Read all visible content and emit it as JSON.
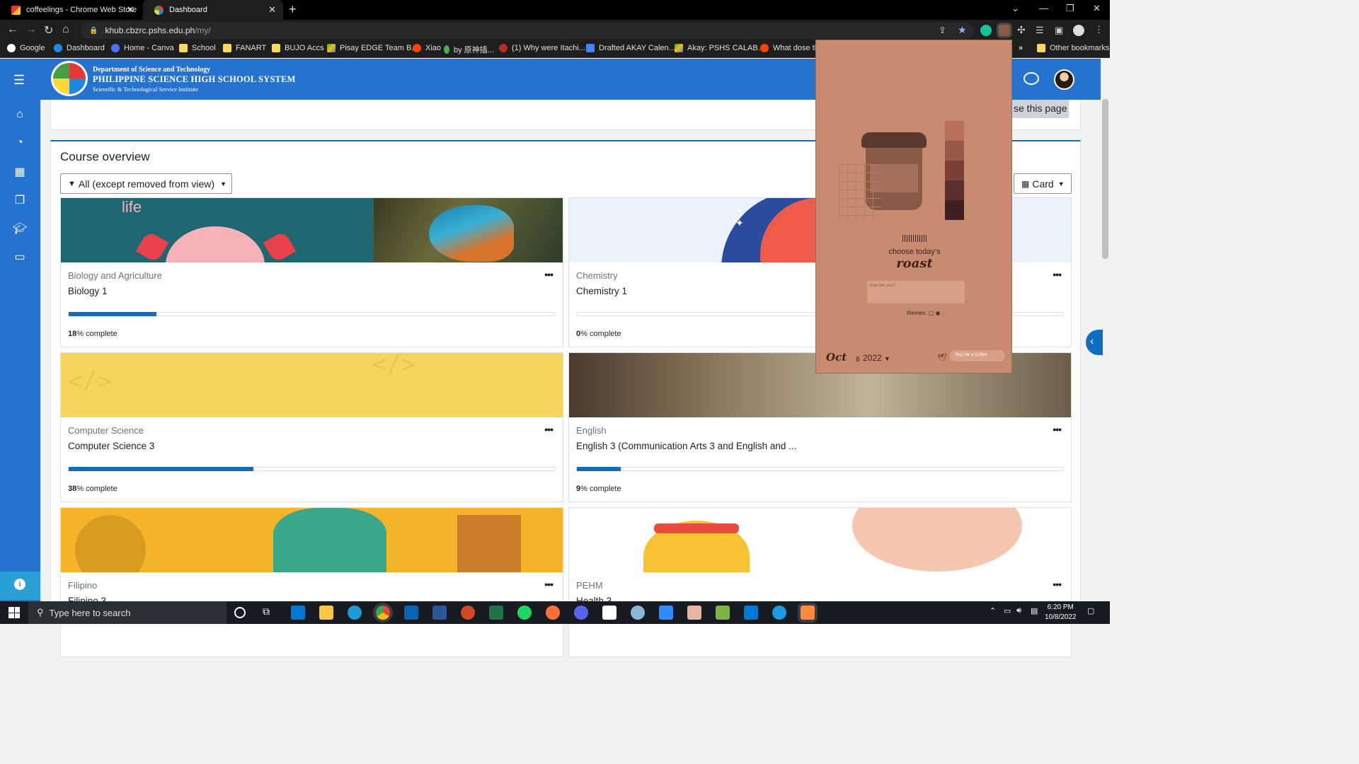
{
  "browser": {
    "tabs": [
      {
        "title": "coffeelings - Chrome Web Store"
      },
      {
        "title": "Dashboard"
      }
    ],
    "url_host": "khub.cbzrc.pshs.edu.ph",
    "url_path": "/my/",
    "bookmarks": [
      "Google",
      "Dashboard",
      "Home - Canva",
      "School",
      "FANART",
      "BUJO Accs",
      "Pisay EDGE Team B...",
      "Xiao",
      "by 原神插...",
      "(1) Why were Itachi...",
      "Drafted AKAY Calen...",
      "Akay: PSHS CALAB...",
      "What dose th"
    ],
    "bookmarks_overflow": "»",
    "other_bookmarks": "Other bookmarks"
  },
  "header": {
    "org_line1": "Department of Science and Technology",
    "org_line2": "PHILIPPINE SCIENCE HIGH SCHOOL SYSTEM",
    "org_line3": "Scientific & Technological Service Institute"
  },
  "top_card": {
    "reset_label": "se this page"
  },
  "course_overview": {
    "title": "Course overview",
    "filter_label": "All (except removed from view)",
    "view_label": "Card",
    "courses": [
      {
        "category": "Biology and Agriculture",
        "name": "Biology 1",
        "progress": 18,
        "complete_label": "% complete",
        "progress_pct": "18"
      },
      {
        "category": "Chemistry",
        "name": "Chemistry 1",
        "progress": 0,
        "complete_label": "% complete",
        "progress_pct": "0"
      },
      {
        "category": "Computer Science",
        "name": "Computer Science 3",
        "progress": 38,
        "complete_label": "% complete",
        "progress_pct": "38"
      },
      {
        "category": "English",
        "name": "English 3 (Communication Arts 3 and English and ...",
        "progress": 9,
        "complete_label": "% complete",
        "progress_pct": "9"
      },
      {
        "category": "Filipino",
        "name": "Filipino 3",
        "progress": null,
        "complete_label": "",
        "progress_pct": ""
      },
      {
        "category": "PEHM",
        "name": "Health 3",
        "progress": null,
        "complete_label": "",
        "progress_pct": ""
      }
    ],
    "banner_text": "life"
  },
  "extension_popup": {
    "line1": "choose today's",
    "line2": "roast",
    "input_placeholder": "how are you?",
    "themes_label": "themes:",
    "month": "Oct",
    "day": "8",
    "year": "2022",
    "bmc_label": "Buy Me a Coffee",
    "swatches": [
      "#b8705a",
      "#9a5a4a",
      "#7a4038",
      "#5c3030",
      "#3e1f22"
    ]
  },
  "taskbar": {
    "search_placeholder": "Type here to search",
    "time": "6:20 PM",
    "date": "10/8/2022"
  },
  "colors": {
    "accent": "#0f6cbf",
    "header_blue": "#2673cf",
    "popup_bg": "#c98b70"
  }
}
